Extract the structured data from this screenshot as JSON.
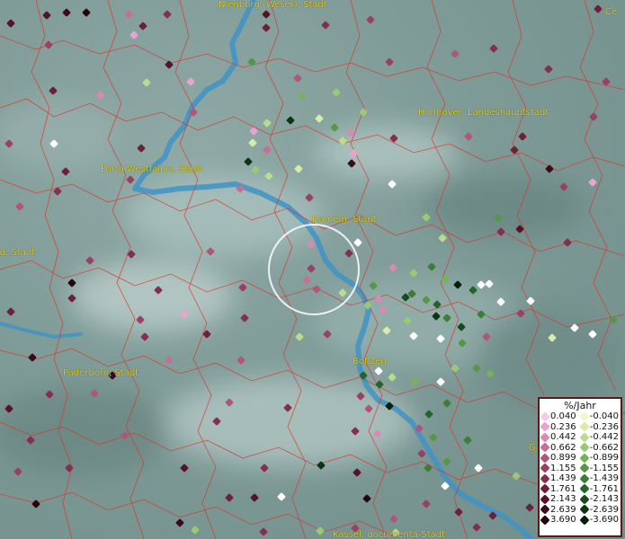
{
  "map": {
    "cities": {
      "nienburg": "Nienburg (Weser), Stadt",
      "porta": "Porta Westfalica, Stadt",
      "hameln": "Hameln, Stadt",
      "hannover": "Hannover, Landeshauptstadt",
      "lippstadt": "ld, Stadt",
      "paderborn": "Paderborn, Stadt",
      "boffzen": "Boffzen",
      "kassel": "Kassel, documenta-Stadt",
      "edge_ne": "Ce",
      "edge_se": "G"
    },
    "legend": {
      "title": "%/Jahr",
      "positive": [
        {
          "label": "0.040",
          "color": "#f7c8e8"
        },
        {
          "label": "0.236",
          "color": "#eaa2cf"
        },
        {
          "label": "0.442",
          "color": "#d98ab2"
        },
        {
          "label": "0.662",
          "color": "#c56f95"
        },
        {
          "label": "0.899",
          "color": "#b0567a"
        },
        {
          "label": "1.155",
          "color": "#9a4064"
        },
        {
          "label": "1.439",
          "color": "#852f50"
        },
        {
          "label": "1.761",
          "color": "#6e1f3a"
        },
        {
          "label": "2.143",
          "color": "#561227"
        },
        {
          "label": "2.639",
          "color": "#3e0918"
        },
        {
          "label": "3.690",
          "color": "#26030a"
        }
      ],
      "negative": [
        {
          "label": "-0.040",
          "color": "#f1f7c6"
        },
        {
          "label": "-0.236",
          "color": "#d8ecaa"
        },
        {
          "label": "-0.442",
          "color": "#b9dd8d"
        },
        {
          "label": "-0.662",
          "color": "#97ca72"
        },
        {
          "label": "-0.899",
          "color": "#75b35a"
        },
        {
          "label": "-1.155",
          "color": "#549847"
        },
        {
          "label": "-1.439",
          "color": "#3a7e38"
        },
        {
          "label": "-1.761",
          "color": "#25652b"
        },
        {
          "label": "-2.143",
          "color": "#154d1e"
        },
        {
          "label": "-2.639",
          "color": "#0b3513"
        },
        {
          "label": "-3.690",
          "color": "#03200a"
        }
      ]
    },
    "colors": {
      "river": "#3f93c7",
      "borders": "#e0301f",
      "label": "#e0d21a",
      "white_marker": "#ffffff"
    }
  }
}
